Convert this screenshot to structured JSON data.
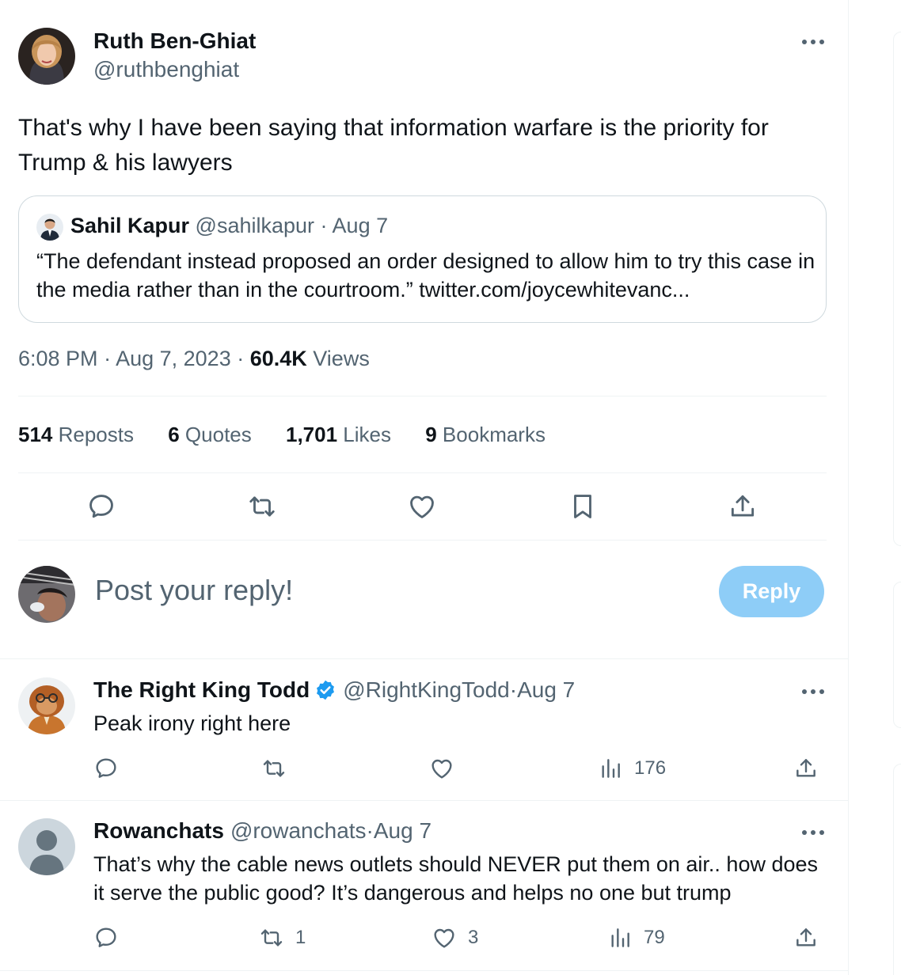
{
  "colors": {
    "accent": "#1d9bf0",
    "reply_button_disabled": "#8ecdf7",
    "muted": "#536471",
    "border": "#eff3f4"
  },
  "tweet": {
    "author": {
      "name": "Ruth Ben-Ghiat",
      "handle": "@ruthbenghiat"
    },
    "text": "That's why I have been saying that information warfare is the priority for Trump & his lawyers",
    "quoted": {
      "author_name": "Sahil Kapur",
      "handle": "@sahilkapur",
      "separator": " · ",
      "date": "Aug 7",
      "text": "“The defendant instead proposed an order designed to allow him to try this case in the media rather than in the courtroom.” twitter.com/joycewhitevanc..."
    },
    "time": "6:08 PM",
    "date": "Aug 7, 2023",
    "sep": " · ",
    "views_count": "60.4K",
    "views_label": " Views",
    "stats": [
      {
        "count": "514",
        "label": " Reposts"
      },
      {
        "count": "6",
        "label": " Quotes"
      },
      {
        "count": "1,701",
        "label": " Likes"
      },
      {
        "count": "9",
        "label": " Bookmarks"
      }
    ],
    "actions": [
      "reply-icon",
      "repost-icon",
      "like-icon",
      "bookmark-icon",
      "share-icon"
    ]
  },
  "reply_box": {
    "placeholder": "Post your reply!",
    "button_label": "Reply"
  },
  "replies": [
    {
      "name": "The Right King Todd",
      "verified": true,
      "handle": "@RightKingTodd",
      "sep": " · ",
      "date": "Aug 7",
      "text": "Peak irony right here",
      "reposts": "",
      "likes": "",
      "views": "176"
    },
    {
      "name": "Rowanchats",
      "verified": false,
      "handle": "@rowanchats",
      "sep": " · ",
      "date": "Aug 7",
      "text": "That’s why the cable news outlets should NEVER put them on air.. how does it serve the public good?  It’s dangerous and helps no one but trump",
      "reposts": "1",
      "likes": "3",
      "views": "79"
    }
  ]
}
